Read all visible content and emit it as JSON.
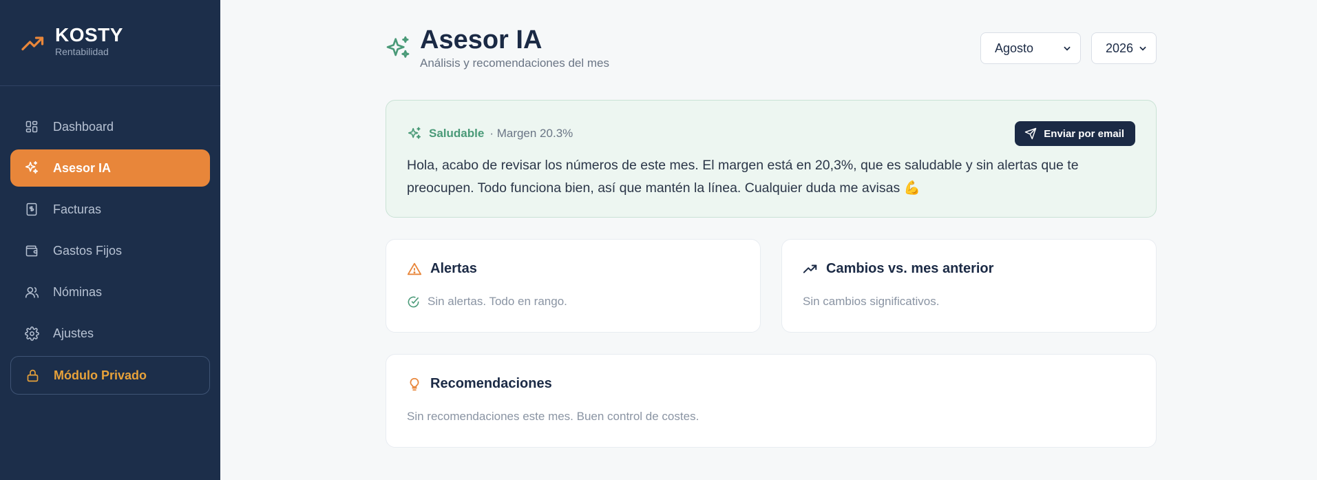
{
  "brand": {
    "name": "KOSTY",
    "subtitle": "Rentabilidad",
    "icon": "trending-up-icon"
  },
  "sidebar": {
    "items": [
      {
        "label": "Dashboard",
        "icon": "grid-icon",
        "active": false
      },
      {
        "label": "Asesor IA",
        "icon": "sparkles-icon",
        "active": true
      },
      {
        "label": "Facturas",
        "icon": "invoice-icon",
        "active": false
      },
      {
        "label": "Gastos Fijos",
        "icon": "wallet-icon",
        "active": false
      },
      {
        "label": "Nóminas",
        "icon": "users-icon",
        "active": false
      },
      {
        "label": "Ajustes",
        "icon": "gear-icon",
        "active": false
      }
    ],
    "private": {
      "label": "Módulo Privado",
      "icon": "lock-icon"
    }
  },
  "header": {
    "title": "Asesor IA",
    "subtitle": "Análisis y recomendaciones del mes",
    "month": {
      "value": "Agosto"
    },
    "year": {
      "value": "2026"
    }
  },
  "summary": {
    "status": "Saludable",
    "margin": "· Margen 20.3%",
    "email_button": "Enviar por email",
    "text": "Hola, acabo de revisar los números de este mes. El margen está en 20,3%, que es saludable y sin alertas que te preocupen. Todo funciona bien, así que mantén la línea. Cualquier duda me avisas 💪"
  },
  "alerts": {
    "title": "Alertas",
    "body": "Sin alertas. Todo en rango."
  },
  "changes": {
    "title": "Cambios vs. mes anterior",
    "body": "Sin cambios significativos."
  },
  "recommendations": {
    "title": "Recomendaciones",
    "body": "Sin recomendaciones este mes. Buen control de costes."
  },
  "colors": {
    "sidebar_bg": "#1c2e4a",
    "accent_orange": "#e8863a",
    "private_gold": "#e8a23a",
    "healthy_green": "#4a9a78",
    "navy": "#1b2a45"
  }
}
